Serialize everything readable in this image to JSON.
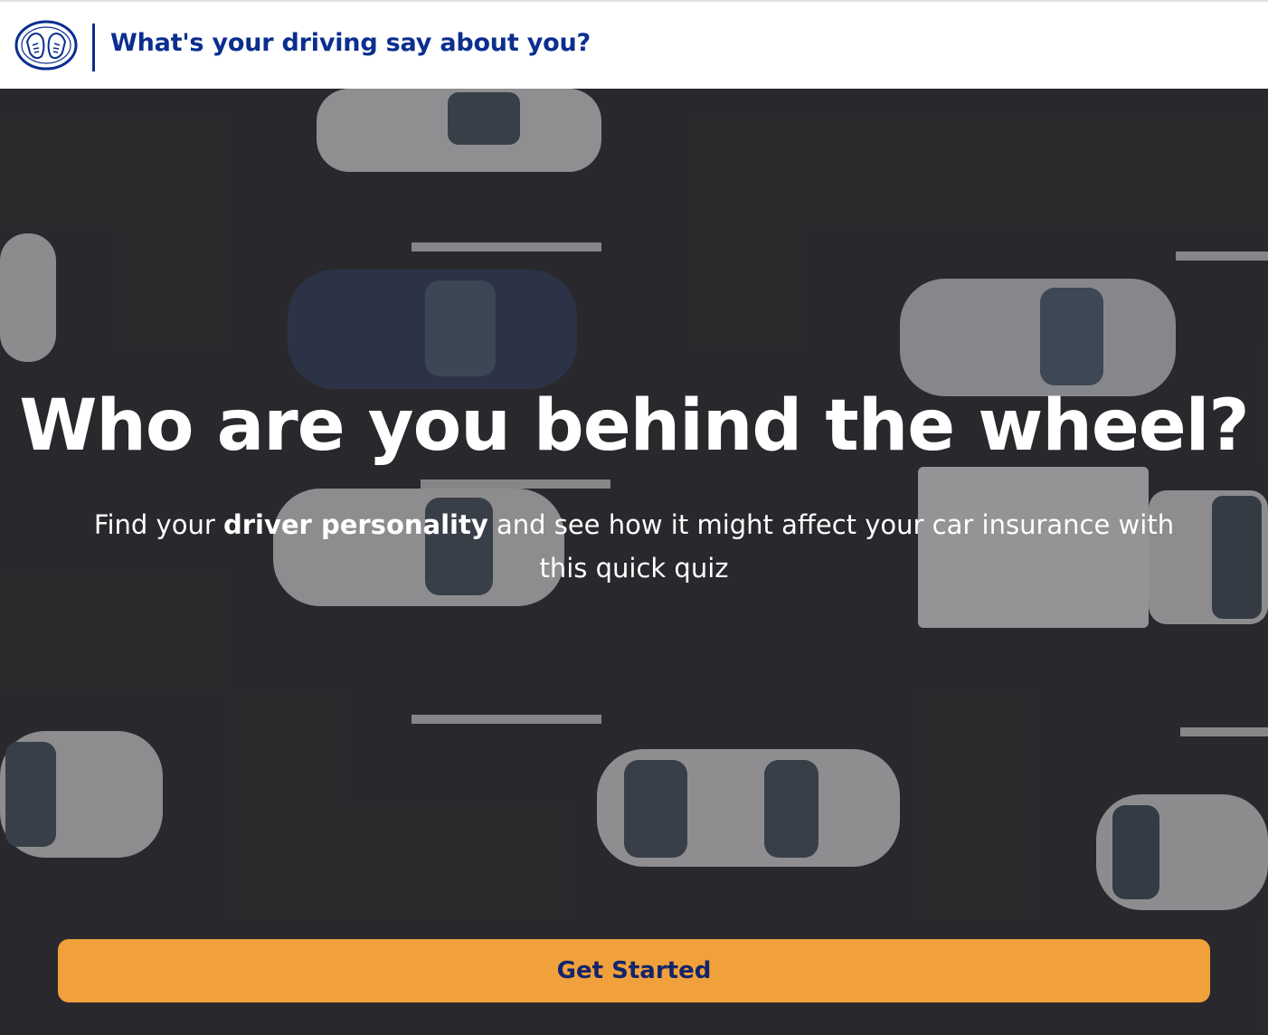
{
  "header": {
    "logo_icon": "allstate-hands-icon",
    "title": "What's your driving say about you?"
  },
  "hero": {
    "background": "aerial-traffic-image",
    "headline": "Who are you behind the wheel?",
    "subtext": {
      "before": "Find your ",
      "bold": "driver personality",
      "after": " and see how it might affect your car insurance with this quick quiz"
    },
    "cta_label": "Get Started"
  },
  "colors": {
    "brand_blue": "#0b2e8f",
    "cta_orange": "#f0a13c",
    "cta_text": "#13246b",
    "road": "#2a2a2c"
  }
}
